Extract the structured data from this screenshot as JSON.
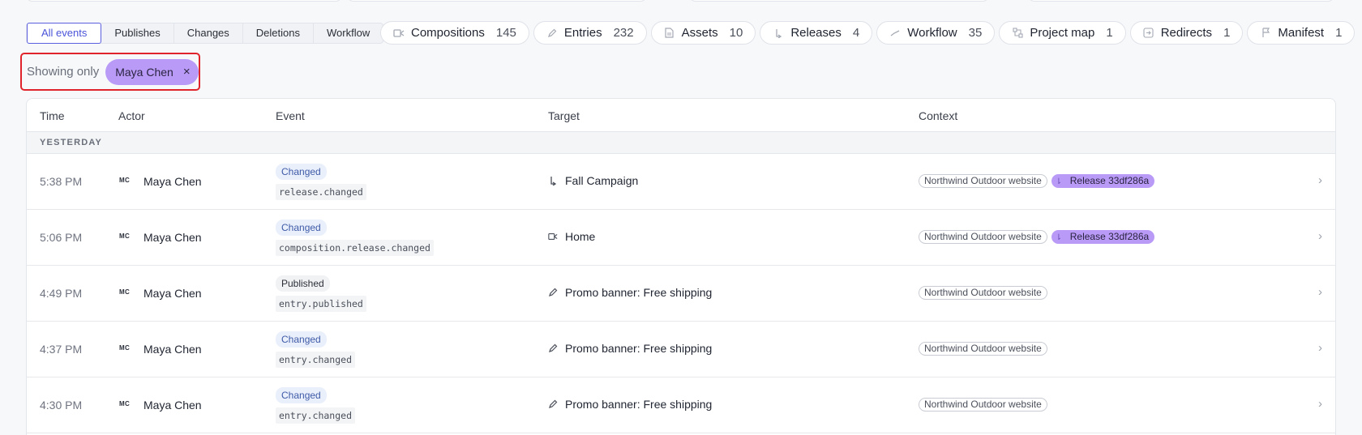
{
  "segments": [
    {
      "label": "All events",
      "active": true
    },
    {
      "label": "Publishes",
      "active": false
    },
    {
      "label": "Changes",
      "active": false
    },
    {
      "label": "Deletions",
      "active": false
    },
    {
      "label": "Workflow",
      "active": false
    }
  ],
  "pills": [
    {
      "label": "Compositions",
      "count": "145",
      "icon": "composition-icon"
    },
    {
      "label": "Entries",
      "count": "232",
      "icon": "pencil-icon"
    },
    {
      "label": "Assets",
      "count": "10",
      "icon": "document-icon"
    },
    {
      "label": "Releases",
      "count": "4",
      "icon": "release-icon"
    },
    {
      "label": "Workflow",
      "count": "35",
      "icon": "workflow-icon"
    },
    {
      "label": "Project map",
      "count": "1",
      "icon": "sitemap-icon"
    },
    {
      "label": "Redirects",
      "count": "1",
      "icon": "redirect-icon"
    },
    {
      "label": "Manifest",
      "count": "1",
      "icon": "flag-icon"
    }
  ],
  "filter": {
    "label": "Showing only",
    "chip": "Maya Chen",
    "remove": "×"
  },
  "table": {
    "headers": {
      "time": "Time",
      "actor": "Actor",
      "event": "Event",
      "target": "Target",
      "context": "Context"
    },
    "group": "YESTERDAY",
    "rows": [
      {
        "time": "5:38 PM",
        "avatar": "MC",
        "actor": "Maya Chen",
        "badge": "Changed",
        "code": "release.changed",
        "target": "Fall Campaign",
        "target_icon": "release-icon",
        "context": [
          "Northwind Outdoor website"
        ],
        "release": "Release 33df286a"
      },
      {
        "time": "5:06 PM",
        "avatar": "MC",
        "actor": "Maya Chen",
        "badge": "Changed",
        "code": "composition.release.changed",
        "target": "Home",
        "target_icon": "composition-icon",
        "context": [
          "Northwind Outdoor website"
        ],
        "release": "Release 33df286a"
      },
      {
        "time": "4:49 PM",
        "avatar": "MC",
        "actor": "Maya Chen",
        "badge": "Published",
        "code": "entry.published",
        "target": "Promo banner: Free shipping",
        "target_icon": "pencil-icon",
        "context": [
          "Northwind Outdoor website"
        ],
        "release": ""
      },
      {
        "time": "4:37 PM",
        "avatar": "MC",
        "actor": "Maya Chen",
        "badge": "Changed",
        "code": "entry.changed",
        "target": "Promo banner: Free shipping",
        "target_icon": "pencil-icon",
        "context": [
          "Northwind Outdoor website"
        ],
        "release": ""
      },
      {
        "time": "4:30 PM",
        "avatar": "MC",
        "actor": "Maya Chen",
        "badge": "Changed",
        "code": "entry.changed",
        "target": "Promo banner: Free shipping",
        "target_icon": "pencil-icon",
        "context": [
          "Northwind Outdoor website"
        ],
        "release": ""
      }
    ],
    "chevron": "›"
  },
  "colors": {
    "accent": "#5b5fe0",
    "chip": "#b99bf7",
    "highlight_border": "#e0242b"
  }
}
